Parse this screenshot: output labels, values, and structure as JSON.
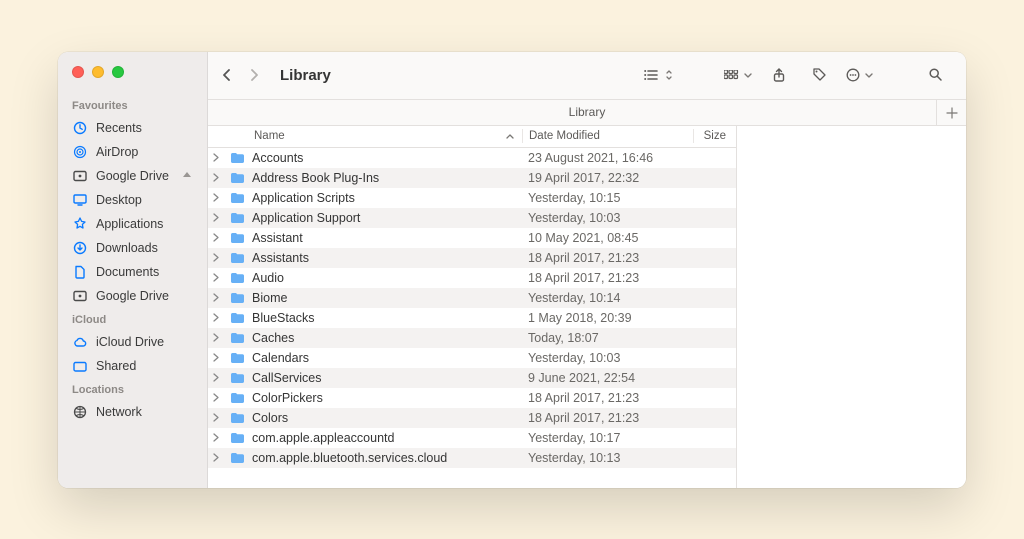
{
  "window": {
    "title": "Library"
  },
  "pathbar": {
    "label": "Library"
  },
  "sidebar": {
    "sections": [
      {
        "label": "Favourites",
        "items": [
          {
            "icon": "clock",
            "label": "Recents"
          },
          {
            "icon": "airdrop",
            "label": "AirDrop"
          },
          {
            "icon": "gdrive",
            "label": "Google Drive",
            "eject": true
          },
          {
            "icon": "desktop",
            "label": "Desktop"
          },
          {
            "icon": "apps",
            "label": "Applications"
          },
          {
            "icon": "download",
            "label": "Downloads"
          },
          {
            "icon": "doc",
            "label": "Documents"
          },
          {
            "icon": "gdrive",
            "label": "Google Drive"
          }
        ]
      },
      {
        "label": "iCloud",
        "items": [
          {
            "icon": "cloud",
            "label": "iCloud Drive"
          },
          {
            "icon": "shared",
            "label": "Shared"
          }
        ]
      },
      {
        "label": "Locations",
        "items": [
          {
            "icon": "network",
            "label": "Network"
          }
        ]
      }
    ]
  },
  "columns": {
    "name": "Name",
    "date": "Date Modified",
    "size": "Size"
  },
  "files": [
    {
      "name": "Accounts",
      "date": "23 August 2021, 16:46"
    },
    {
      "name": "Address Book Plug-Ins",
      "date": "19 April 2017, 22:32"
    },
    {
      "name": "Application Scripts",
      "date": "Yesterday, 10:15"
    },
    {
      "name": "Application Support",
      "date": "Yesterday, 10:03"
    },
    {
      "name": "Assistant",
      "date": "10 May 2021, 08:45"
    },
    {
      "name": "Assistants",
      "date": "18 April 2017, 21:23"
    },
    {
      "name": "Audio",
      "date": "18 April 2017, 21:23"
    },
    {
      "name": "Biome",
      "date": "Yesterday, 10:14"
    },
    {
      "name": "BlueStacks",
      "date": "1 May 2018, 20:39"
    },
    {
      "name": "Caches",
      "date": "Today, 18:07"
    },
    {
      "name": "Calendars",
      "date": "Yesterday, 10:03"
    },
    {
      "name": "CallServices",
      "date": "9 June 2021, 22:54"
    },
    {
      "name": "ColorPickers",
      "date": "18 April 2017, 21:23"
    },
    {
      "name": "Colors",
      "date": "18 April 2017, 21:23"
    },
    {
      "name": "com.apple.appleaccountd",
      "date": "Yesterday, 10:17"
    },
    {
      "name": "com.apple.bluetooth.services.cloud",
      "date": "Yesterday, 10:13"
    }
  ]
}
